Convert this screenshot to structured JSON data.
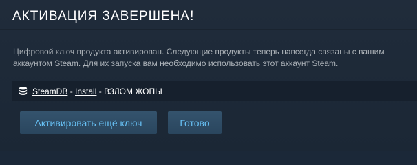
{
  "dialog": {
    "title": "АКТИВАЦИЯ ЗАВЕРШЕНА!",
    "description": "Цифровой ключ продукта активирован. Следующие продукты теперь навсегда связаны с вашим аккаунтом Steam. Для их запуска вам необходимо использовать этот аккаунт Steam."
  },
  "product": {
    "icon": "database-icon",
    "name": "SteamDB",
    "separator_1": " - ",
    "install_label": "Install",
    "separator_2": " - ",
    "package_name": "ВЗЛОМ ЖОПЫ"
  },
  "buttons": {
    "activate_another_label": "Активировать ещё ключ",
    "done_label": "Готово"
  },
  "colors": {
    "background": "#1e2a3a",
    "title": "#ffffff",
    "description": "#acb2b8",
    "product_row_bg": "#16202d",
    "button_bg": "#2d4a63",
    "button_text": "#67c1f5"
  }
}
